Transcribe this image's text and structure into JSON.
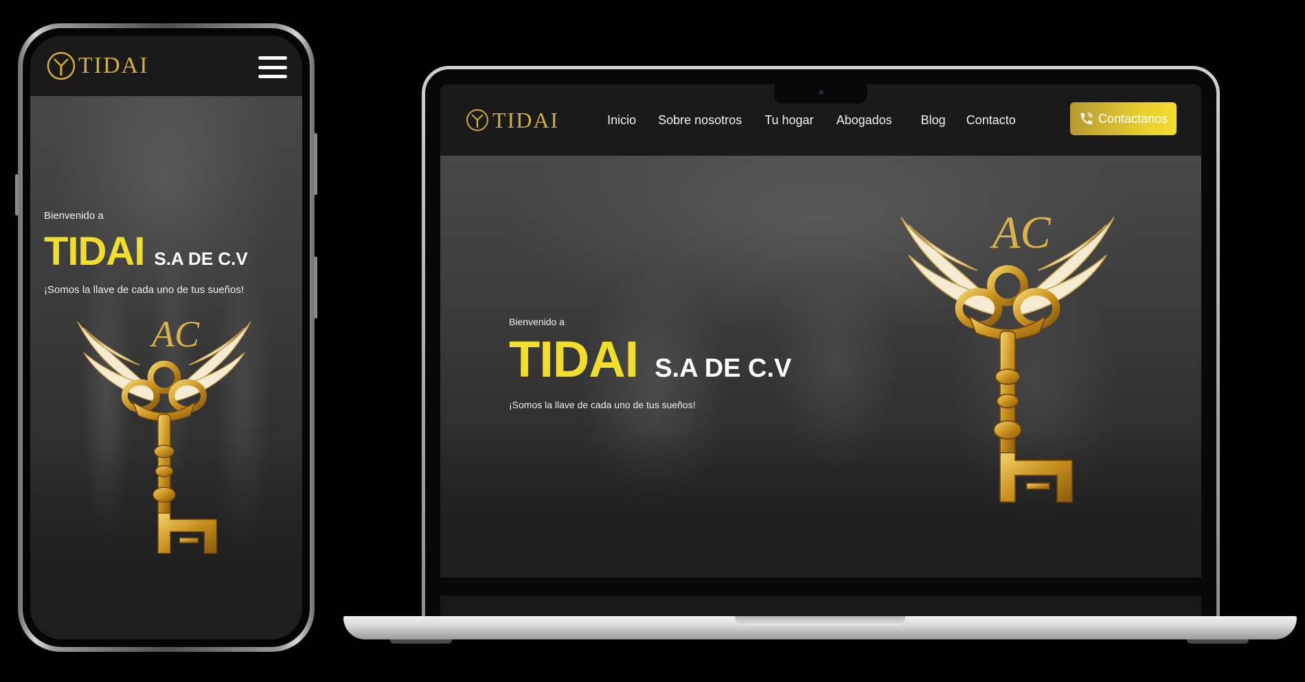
{
  "site": {
    "logo_text": "TIDAI",
    "nav": [
      "Inicio",
      "Sobre nosotros",
      "Tu hogar",
      "Abogados",
      "Blog",
      "Contacto"
    ],
    "cta_label": "Contactanos"
  },
  "hero": {
    "welcome": "Bienvenido a",
    "brand": "TIDAI",
    "brand_suffix": "S.A DE C.V",
    "tagline": "¡Somos la llave de cada uno de tus sueños!",
    "emblem_monogram": "AC"
  },
  "colors": {
    "gold": "#d4af37",
    "brand_yellow": "#f1de2c",
    "header_bg": "#1a1a1a"
  },
  "icons": {
    "phone_cta": "phone-icon",
    "mobile_menu": "hamburger-menu-icon",
    "emblem": "winged-key-emblem"
  }
}
